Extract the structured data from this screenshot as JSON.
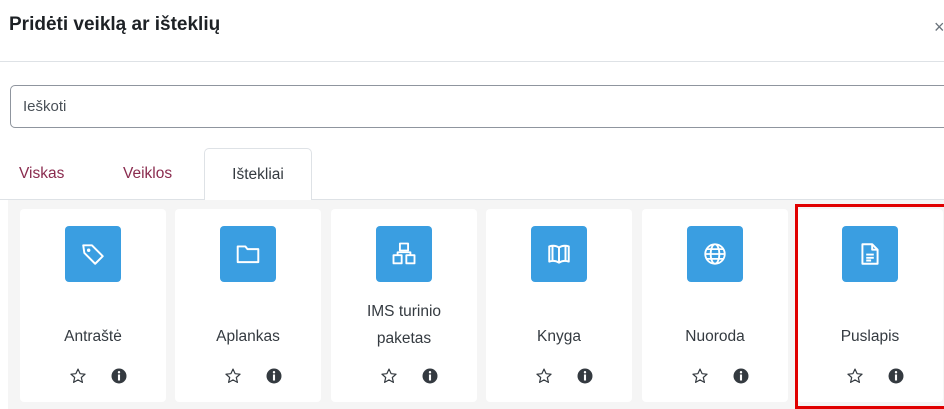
{
  "dialog": {
    "title": "Pridėti veiklą ar išteklių",
    "close_label": "×"
  },
  "search": {
    "placeholder": "Ieškoti"
  },
  "tabs": [
    {
      "label": "Viskas"
    },
    {
      "label": "Veiklos"
    },
    {
      "label": "Ištekliai"
    }
  ],
  "active_tab": "Ištekliai",
  "items": [
    {
      "label": "Antraštė",
      "icon": "tag-icon"
    },
    {
      "label": "Aplankas",
      "icon": "folder-icon"
    },
    {
      "label_line1": "IMS turinio",
      "label_line2": "paketas",
      "icon": "package-icon"
    },
    {
      "label": "Knyga",
      "icon": "book-icon"
    },
    {
      "label": "Nuoroda",
      "icon": "globe-icon"
    },
    {
      "label": "Puslapis",
      "icon": "page-icon"
    }
  ],
  "colors": {
    "tile": "#3a9ee1",
    "tab_link": "#8a2b4e",
    "highlight": "#e00000"
  }
}
